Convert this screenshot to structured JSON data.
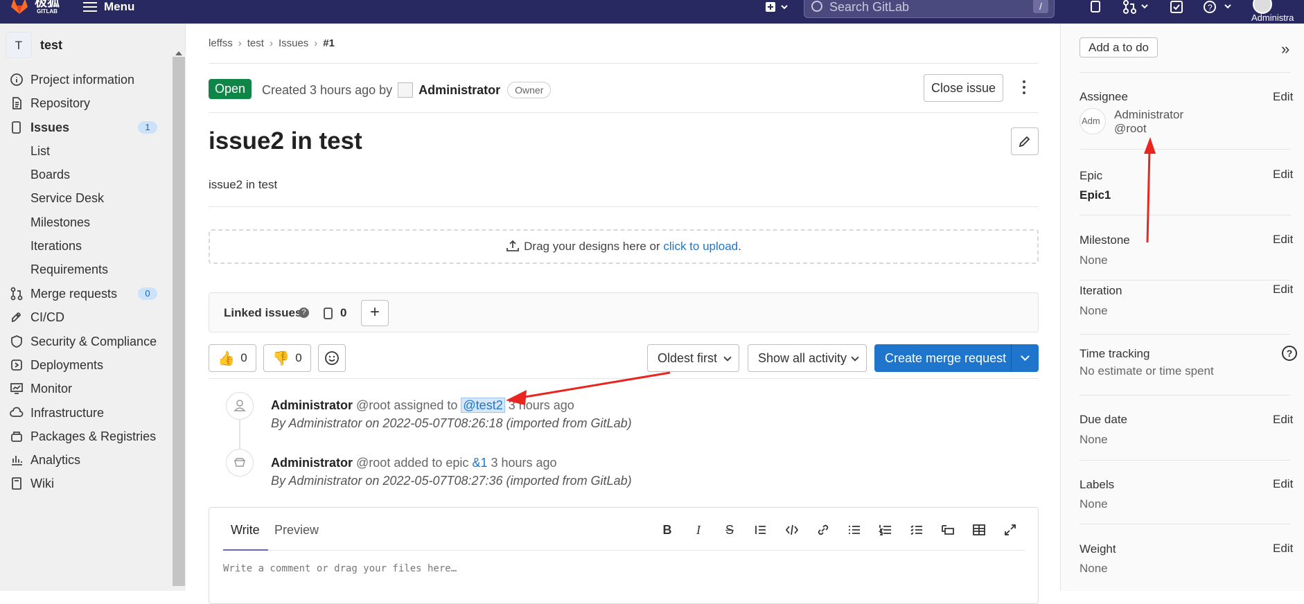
{
  "topbar": {
    "logo_text": "极狐",
    "logo_sub": "GITLAB",
    "menu_label": "Menu",
    "search_placeholder": "Search GitLab",
    "search_shortcut": "/",
    "user_label": "Administra"
  },
  "sidebar": {
    "project_initial": "T",
    "project_name": "test",
    "items": [
      {
        "label": "Project information",
        "icon": "info-icon"
      },
      {
        "label": "Repository",
        "icon": "document-icon"
      },
      {
        "label": "Issues",
        "icon": "issues-icon",
        "badge": "1",
        "active": true
      },
      {
        "label": "List",
        "sub": true
      },
      {
        "label": "Boards",
        "sub": true
      },
      {
        "label": "Service Desk",
        "sub": true
      },
      {
        "label": "Milestones",
        "sub": true
      },
      {
        "label": "Iterations",
        "sub": true
      },
      {
        "label": "Requirements",
        "sub": true
      },
      {
        "label": "Merge requests",
        "icon": "merge-request-icon",
        "badge": "0"
      },
      {
        "label": "CI/CD",
        "icon": "rocket-icon"
      },
      {
        "label": "Security & Compliance",
        "icon": "shield-icon"
      },
      {
        "label": "Deployments",
        "icon": "deployments-icon"
      },
      {
        "label": "Monitor",
        "icon": "monitor-icon"
      },
      {
        "label": "Infrastructure",
        "icon": "cloud-icon"
      },
      {
        "label": "Packages & Registries",
        "icon": "package-icon"
      },
      {
        "label": "Analytics",
        "icon": "chart-icon"
      },
      {
        "label": "Wiki",
        "icon": "book-icon"
      }
    ]
  },
  "breadcrumb": [
    "leffss",
    "test",
    "Issues",
    "#1"
  ],
  "issue": {
    "status": "Open",
    "created_prefix": "Created 3 hours ago by",
    "author": "Administrator",
    "role": "Owner",
    "close_label": "Close issue",
    "title": "issue2 in test",
    "description": "issue2 in test",
    "upload_text": "Drag your designs here or",
    "upload_link": "click to upload",
    "upload_end": "."
  },
  "linked": {
    "title": "Linked issues",
    "help": "?",
    "count": "0",
    "add": "+"
  },
  "reactions": {
    "thumbsup": "0",
    "thumbsdown": "0"
  },
  "controls": {
    "sort": "Oldest first",
    "filter": "Show all activity",
    "merge_request": "Create merge request"
  },
  "activity": [
    {
      "author": "Administrator",
      "pre": "@root assigned to",
      "ref": "@test2",
      "post": "3 hours ago",
      "sub": "By Administrator on 2022-05-07T08:26:18 (imported from GitLab)"
    },
    {
      "author": "Administrator",
      "pre": "@root added to epic",
      "ref": "&1",
      "post": "3 hours ago",
      "sub": "By Administrator on 2022-05-07T08:27:36 (imported from GitLab)"
    }
  ],
  "editor": {
    "tab_write": "Write",
    "tab_preview": "Preview",
    "placeholder": "Write a comment or drag your files here…"
  },
  "right_sidebar": {
    "todo": "Add a to do",
    "edit": "Edit",
    "assignee_label": "Assignee",
    "assignee_name": "Administrator",
    "assignee_user": "@root",
    "assignee_alt": "Adm",
    "epic_label": "Epic",
    "epic_value": "Epic1",
    "milestone_label": "Milestone",
    "milestone_value": "None",
    "iteration_label": "Iteration",
    "iteration_value": "None",
    "time_label": "Time tracking",
    "time_value": "No estimate or time spent",
    "due_label": "Due date",
    "due_value": "None",
    "labels_label": "Labels",
    "labels_value": "None",
    "weight_label": "Weight",
    "weight_value": "None"
  },
  "colors": {
    "topbar": "#292961",
    "open": "#108548",
    "primary": "#1f75cb",
    "annotation": "#e8261f"
  }
}
